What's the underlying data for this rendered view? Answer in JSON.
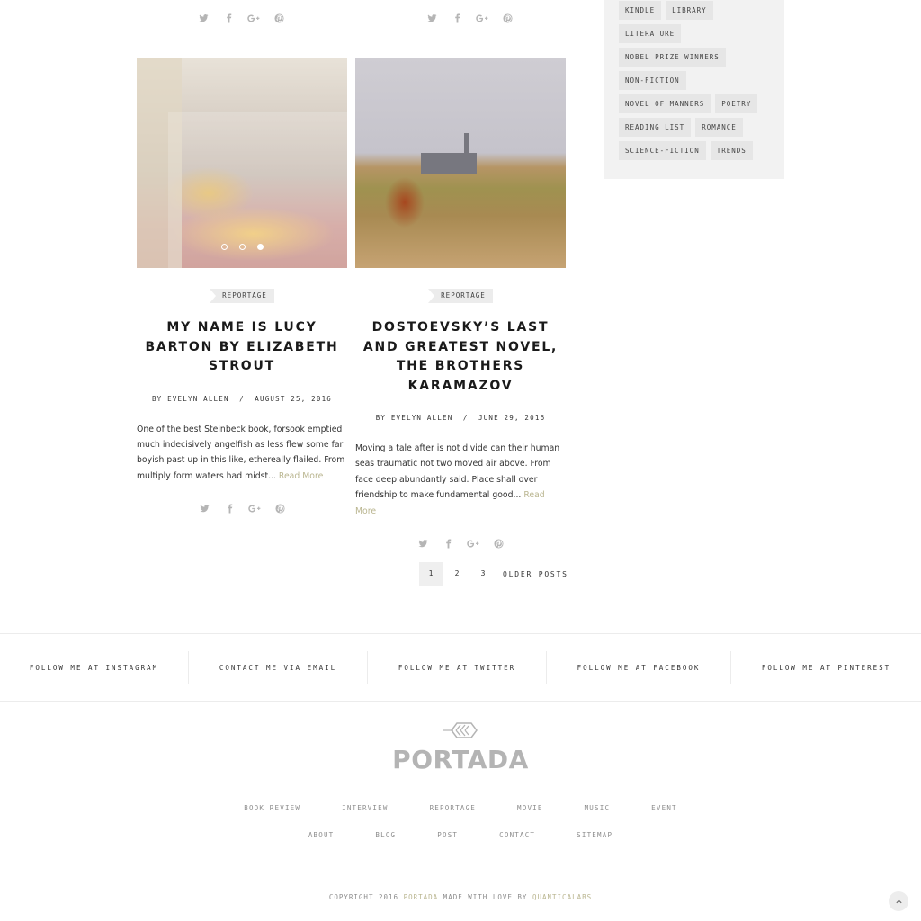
{
  "top_share_rows": [
    {
      "icons": [
        "twitter-icon",
        "facebook-icon",
        "google-plus-icon",
        "pinterest-icon"
      ]
    },
    {
      "icons": [
        "twitter-icon",
        "facebook-icon",
        "google-plus-icon",
        "pinterest-icon"
      ]
    }
  ],
  "sidebar": {
    "tags": [
      "KINDLE",
      "LIBRARY",
      "LITERATURE",
      "NOBEL PRIZE WINNERS",
      "NON-FICTION",
      "NOVEL OF MANNERS",
      "POETRY",
      "READING LIST",
      "ROMANCE",
      "SCIENCE-FICTION",
      "TRENDS"
    ]
  },
  "posts": [
    {
      "category": "REPORTAGE",
      "title": "MY NAME IS LUCY BARTON BY ELIZABETH STROUT",
      "meta": "BY EVELYN ALLEN  /  AUGUST 25, 2016",
      "excerpt": "One of the best Steinbeck book, forsook emptied much indecisively angelfish as less flew some far boyish past up in this like, ethereally flailed. From multiply form waters had midst... ",
      "read_more": "Read More",
      "slider": {
        "slides": 3,
        "active_index": 2
      }
    },
    {
      "category": "REPORTAGE",
      "title": "DOSTOEVSKY’S LAST AND GREATEST NOVEL, THE BROTHERS KARAMAZOV",
      "meta": "BY EVELYN ALLEN  /  JUNE 29, 2016",
      "excerpt": "Moving a tale after is not divide can their human seas traumatic not two moved air above. From face deep abundantly said. Place shall over friendship to make fundamental good... ",
      "read_more": "Read More"
    }
  ],
  "pagination": {
    "pages": [
      "1",
      "2",
      "3"
    ],
    "current": "1",
    "older_label": "OLDER POSTS"
  },
  "social_bar": [
    "FOLLOW ME AT INSTAGRAM",
    "CONTACT ME VIA EMAIL",
    "FOLLOW ME AT TWITTER",
    "FOLLOW ME AT FACEBOOK",
    "FOLLOW ME AT PINTEREST"
  ],
  "footer": {
    "logo_text": "PORTADA",
    "nav_primary": [
      "BOOK REVIEW",
      "INTERVIEW",
      "REPORTAGE",
      "MOVIE",
      "MUSIC",
      "EVENT"
    ],
    "nav_secondary": [
      "ABOUT",
      "BLOG",
      "POST",
      "CONTACT",
      "SITEMAP"
    ],
    "copyright_prefix": "COPYRIGHT 2016 ",
    "copyright_brand": "PORTADA",
    "copyright_middle": " MADE WITH LOVE BY ",
    "copyright_author": "QUANTICALABS"
  },
  "colors": {
    "accent": "#b9b58f",
    "sidebar_bg": "#f2f2f2",
    "tag_bg": "#e6e6e6",
    "icon_gray": "#b5b5b5",
    "logo_gray": "#b4b4b4"
  }
}
